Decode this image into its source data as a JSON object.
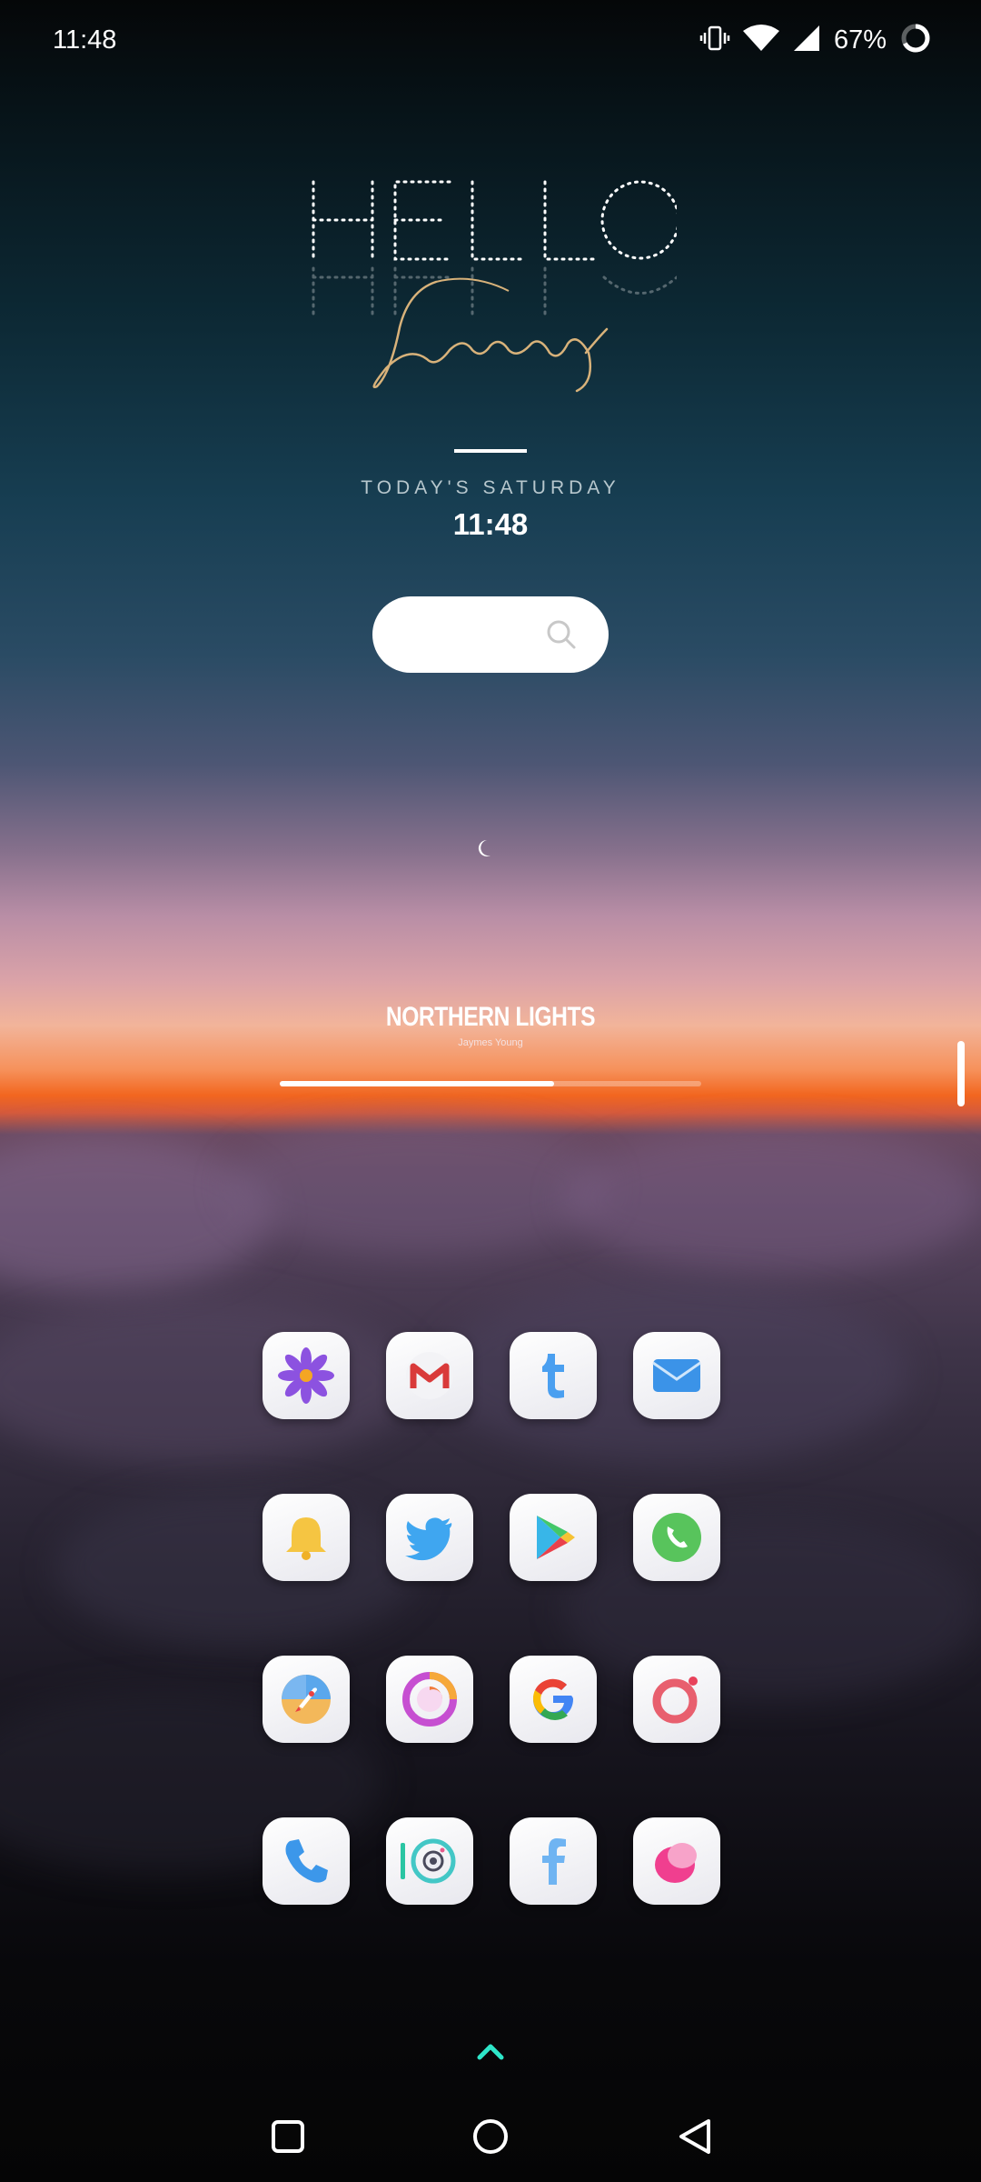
{
  "status_bar": {
    "time": "11:48",
    "battery": "67%",
    "icons": [
      "vibrate-icon",
      "wifi-icon",
      "signal-icon",
      "battery-ring-icon"
    ]
  },
  "widget": {
    "hello": "HELLO",
    "month": "January",
    "day_text": "TODAY'S SATURDAY",
    "time": "11:48"
  },
  "music": {
    "title": "NORTHERN LIGHTS",
    "artist": "Jaymes Young",
    "progress": 0.65
  },
  "apps": [
    {
      "name": "flower-app-icon"
    },
    {
      "name": "gmail-icon"
    },
    {
      "name": "tumblr-icon"
    },
    {
      "name": "mail-icon"
    },
    {
      "name": "notification-bell-icon"
    },
    {
      "name": "twitter-icon"
    },
    {
      "name": "play-store-icon"
    },
    {
      "name": "whatsapp-icon"
    },
    {
      "name": "rocket-launcher-icon"
    },
    {
      "name": "firefox-icon"
    },
    {
      "name": "google-icon"
    },
    {
      "name": "ring-app-icon"
    },
    {
      "name": "phone-icon"
    },
    {
      "name": "camera-icon"
    },
    {
      "name": "facebook-icon"
    },
    {
      "name": "messages-icon"
    }
  ],
  "colors": {
    "accent_teal": "#2ee6c9",
    "sunset_orange": "#f2661f"
  }
}
